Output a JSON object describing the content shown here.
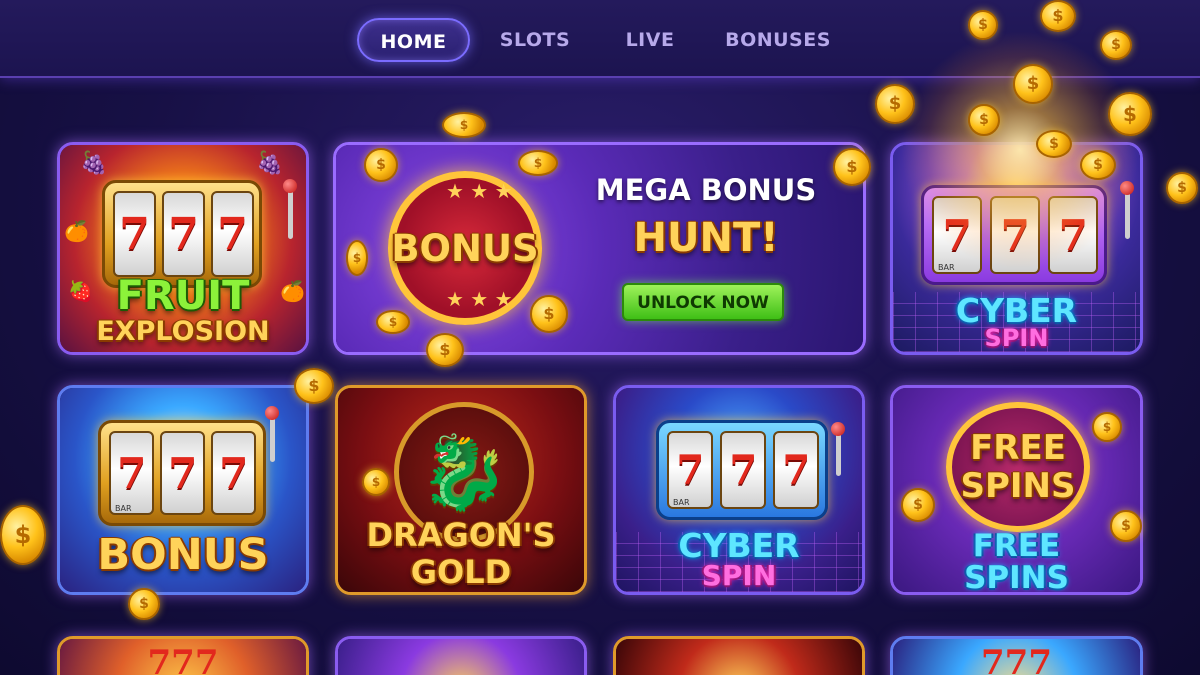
{
  "nav": {
    "tabs": [
      {
        "label": "HOME",
        "active": true
      },
      {
        "label": "SLOTS",
        "active": false
      },
      {
        "label": "LIVE",
        "active": false
      },
      {
        "label": "BONUSES",
        "active": false
      }
    ]
  },
  "promo": {
    "badge": "BONUS",
    "headline_line1": "MEGA BONUS",
    "headline_line2": "HUNT!",
    "cta_label": "UNLOCK NOW"
  },
  "games": [
    {
      "line1": "FRUIT",
      "line2": "EXPLOSION",
      "reels": [
        "7",
        "7",
        "7"
      ]
    },
    {
      "line1": "CYBER",
      "line2": "SPIN",
      "reels": [
        "7",
        "7",
        "7"
      ],
      "reel_label": "BAR"
    },
    {
      "line1": "BONUS",
      "line2": "",
      "reels": [
        "7",
        "7",
        "7"
      ],
      "reel_label": "BAR"
    },
    {
      "line1": "DRAGON'S",
      "line2": "GOLD"
    },
    {
      "line1": "CYBER",
      "line2": "SPIN",
      "reels": [
        "7",
        "7",
        "7"
      ],
      "reel_label": "BAR"
    },
    {
      "badge_line1": "FREE",
      "badge_line2": "SPINS",
      "line1": "FREE",
      "line2": "SPINS"
    }
  ],
  "colors": {
    "background": "#171045",
    "card_border": "#8a5cf0",
    "accent_gold": "#ffd35a",
    "cta_green": "#3fbf16",
    "cyan": "#5ee6ff",
    "pink": "#ff6ee0"
  },
  "icons": [
    "coin-icon",
    "slot-machine-icon",
    "dragon-icon",
    "fruit-icon"
  ]
}
